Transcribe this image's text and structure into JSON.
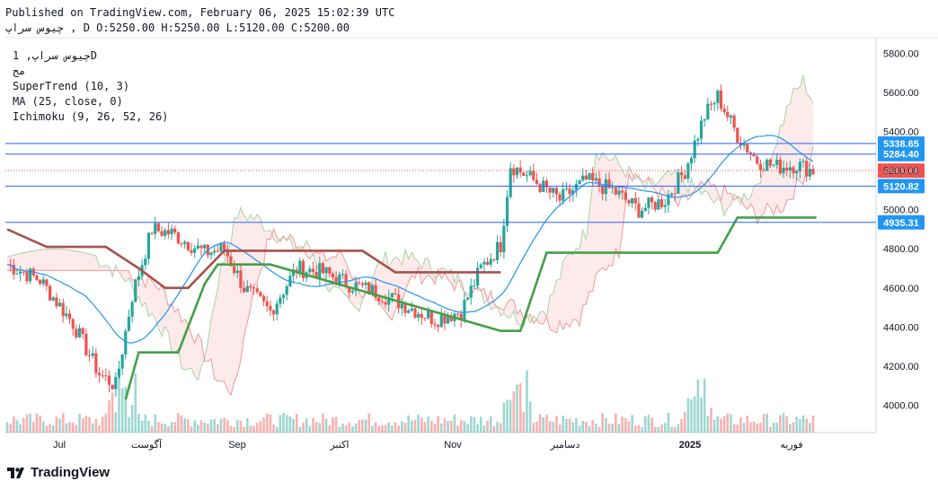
{
  "header": {
    "published": "Published on TradingView.com, February 06, 2025 15:02:39 UTC",
    "symbol_line": "چیوس سراپ , D O:5250.00 H:5250.00 L:5120.00 C:5200.00"
  },
  "legend": {
    "line1": "چیوس سراپ, 1D",
    "line2": "مج",
    "line3": "SuperTrend (10, 3)",
    "line4": "MA (25, close, 0)",
    "line5": "Ichimoku (9, 26, 52, 26)"
  },
  "footer": {
    "brand": "TradingView"
  },
  "colors": {
    "up": "#26a69a",
    "down": "#ef5350",
    "ma": "#2196f3",
    "supertrend_up": "#43a047",
    "supertrend_down": "#a5514c",
    "hline": "#2962ff",
    "price_badge": "#ef5350",
    "level_badge": "#2196f3"
  },
  "chart_data": {
    "type": "candlestick",
    "x_tick_labels": [
      "Jul",
      "آگوست",
      "Sep",
      "اکتبر",
      "Nov",
      "دسامبر",
      "2025",
      "فوریه"
    ],
    "y_ticks": [
      4000,
      4200,
      4400,
      4600,
      4800,
      5000,
      5200,
      5400,
      5600,
      5800
    ],
    "y_tick_labels": [
      "4000.00",
      "4200.00",
      "4400.00",
      "4600.00",
      "4800.00",
      "5000.00",
      "5200.00",
      "5400.00",
      "5600.00",
      "5800.00"
    ],
    "ylim": [
      3860,
      5880
    ],
    "horizontal_levels": [
      {
        "value": 5338.65,
        "label": "5338.65"
      },
      {
        "value": 5284.4,
        "label": "5284.40"
      },
      {
        "value": 5120.82,
        "label": "5120.82"
      },
      {
        "value": 4935.31,
        "label": "4935.31"
      }
    ],
    "last_price": {
      "value": 5200.0,
      "label": "5200.00"
    },
    "ohlc_last": {
      "open": 5250.0,
      "high": 5250.0,
      "low": 5120.0,
      "close": 5200.0
    }
  }
}
